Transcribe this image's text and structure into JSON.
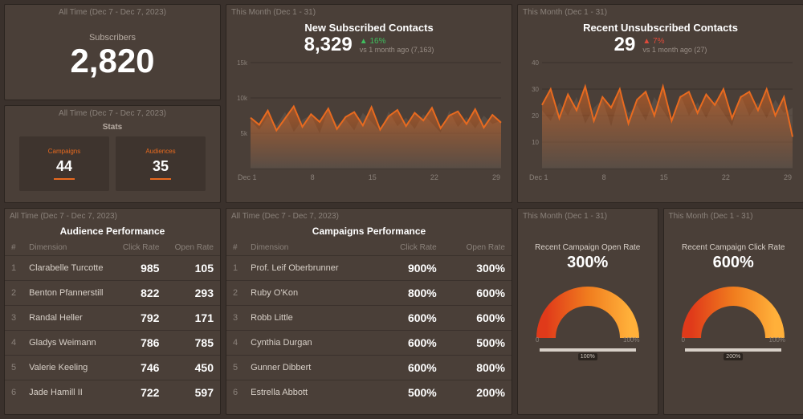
{
  "ranges": {
    "all_time": "All Time (Dec 7 - Dec 7, 2023)",
    "this_month": "This Month (Dec 1 - 31)"
  },
  "subscribers": {
    "label": "Subscribers",
    "value": "2,820"
  },
  "stats": {
    "title": "Stats",
    "items": [
      {
        "label": "Campaigns",
        "value": "44"
      },
      {
        "label": "Audiences",
        "value": "35"
      }
    ]
  },
  "new_contacts": {
    "title": "New Subscribed Contacts",
    "value": "8,329",
    "delta_dir": "up",
    "delta_pct": "16%",
    "delta_sub": "vs 1 month ago (7,163)"
  },
  "unsub_contacts": {
    "title": "Recent Unsubscribed Contacts",
    "value": "29",
    "delta_dir": "down",
    "delta_pct": "7%",
    "delta_sub": "vs 1 month ago (27)"
  },
  "chart_data": [
    {
      "id": "new_subscribed",
      "type": "area",
      "title": "New Subscribed Contacts",
      "x_categories": [
        "Dec 1",
        "8",
        "15",
        "22",
        "29"
      ],
      "ylabel": "",
      "ylim": [
        0,
        15000
      ],
      "y_ticks": [
        0,
        5000,
        10000,
        15000
      ],
      "y_tick_labels": [
        "",
        "5k",
        "10k",
        "15k"
      ],
      "series": [
        {
          "name": "previous",
          "color": "#6a5f57",
          "values": [
            6800,
            5500,
            7400,
            6100,
            8000,
            5200,
            6900,
            7600,
            5000,
            8300,
            6200,
            7000,
            5400,
            7900,
            6600,
            5300,
            8100,
            6000,
            7200,
            5600,
            7700,
            6400,
            5100,
            8200,
            5900,
            7300,
            5700,
            7500,
            6300,
            6800
          ]
        },
        {
          "name": "current",
          "color": "#e86a1f",
          "values": [
            7200,
            6200,
            8200,
            5400,
            7100,
            8800,
            5900,
            7700,
            6600,
            8500,
            5600,
            7300,
            8000,
            6100,
            8700,
            5500,
            7400,
            8300,
            6000,
            7900,
            6800,
            8600,
            5700,
            7500,
            8100,
            6300,
            8400,
            5800,
            7600,
            6500
          ]
        }
      ]
    },
    {
      "id": "unsubscribed",
      "type": "area",
      "title": "Recent Unsubscribed Contacts",
      "x_categories": [
        "Dec 1",
        "8",
        "15",
        "22",
        "29"
      ],
      "ylabel": "",
      "ylim": [
        0,
        40
      ],
      "y_ticks": [
        0,
        10,
        20,
        30,
        40
      ],
      "y_tick_labels": [
        "",
        "10",
        "20",
        "30",
        "40"
      ],
      "series": [
        {
          "name": "previous",
          "color": "#6a5f57",
          "values": [
            22,
            18,
            25,
            20,
            27,
            17,
            23,
            26,
            16,
            28,
            21,
            24,
            18,
            27,
            22,
            17,
            28,
            20,
            25,
            19,
            26,
            21,
            16,
            28,
            20,
            25,
            19,
            26,
            21,
            23
          ]
        },
        {
          "name": "current",
          "color": "#e86a1f",
          "values": [
            24,
            30,
            19,
            28,
            22,
            31,
            18,
            27,
            23,
            30,
            17,
            26,
            29,
            20,
            31,
            18,
            27,
            29,
            21,
            28,
            24,
            30,
            19,
            27,
            29,
            22,
            30,
            20,
            27,
            12
          ]
        }
      ]
    },
    {
      "id": "open_rate_gauge",
      "type": "gauge",
      "title": "Recent Campaign Open Rate",
      "value": 300,
      "display": "300%",
      "range": [
        0,
        100
      ],
      "secondary_value": 100,
      "secondary_display": "100%"
    },
    {
      "id": "click_rate_gauge",
      "type": "gauge",
      "title": "Recent Campaign Click Rate",
      "value": 600,
      "display": "600%",
      "range": [
        0,
        100
      ],
      "secondary_value": 200,
      "secondary_display": "200%"
    }
  ],
  "audience_table": {
    "title": "Audience Performance",
    "cols": {
      "idx": "#",
      "dim": "Dimension",
      "click": "Click Rate",
      "open": "Open Rate"
    },
    "rows": [
      {
        "i": "1",
        "dim": "Clarabelle Turcotte",
        "click": "985",
        "open": "105"
      },
      {
        "i": "2",
        "dim": "Benton Pfannerstill",
        "click": "822",
        "open": "293"
      },
      {
        "i": "3",
        "dim": "Randal Heller",
        "click": "792",
        "open": "171"
      },
      {
        "i": "4",
        "dim": "Gladys Weimann",
        "click": "786",
        "open": "785"
      },
      {
        "i": "5",
        "dim": "Valerie Keeling",
        "click": "746",
        "open": "450"
      },
      {
        "i": "6",
        "dim": "Jade Hamill II",
        "click": "722",
        "open": "597"
      }
    ]
  },
  "campaigns_table": {
    "title": "Campaigns Performance",
    "cols": {
      "idx": "#",
      "dim": "Dimension",
      "click": "Click Rate",
      "open": "Open Rate"
    },
    "rows": [
      {
        "i": "1",
        "dim": "Prof. Leif Oberbrunner",
        "click": "900%",
        "open": "300%"
      },
      {
        "i": "2",
        "dim": "Ruby O'Kon",
        "click": "800%",
        "open": "600%"
      },
      {
        "i": "3",
        "dim": "Robb Little",
        "click": "600%",
        "open": "600%"
      },
      {
        "i": "4",
        "dim": "Cynthia Durgan",
        "click": "600%",
        "open": "500%"
      },
      {
        "i": "5",
        "dim": "Gunner Dibbert",
        "click": "600%",
        "open": "800%"
      },
      {
        "i": "6",
        "dim": "Estrella Abbott",
        "click": "500%",
        "open": "200%"
      }
    ]
  },
  "gauges": {
    "open": {
      "title": "Recent Campaign Open Rate",
      "value": "300%",
      "min": "0",
      "max": "100%",
      "bar_pct": 100,
      "bar_label": "100%"
    },
    "click": {
      "title": "Recent Campaign Click Rate",
      "value": "600%",
      "min": "0",
      "max": "100%",
      "bar_pct": 100,
      "bar_label": "200%"
    }
  }
}
